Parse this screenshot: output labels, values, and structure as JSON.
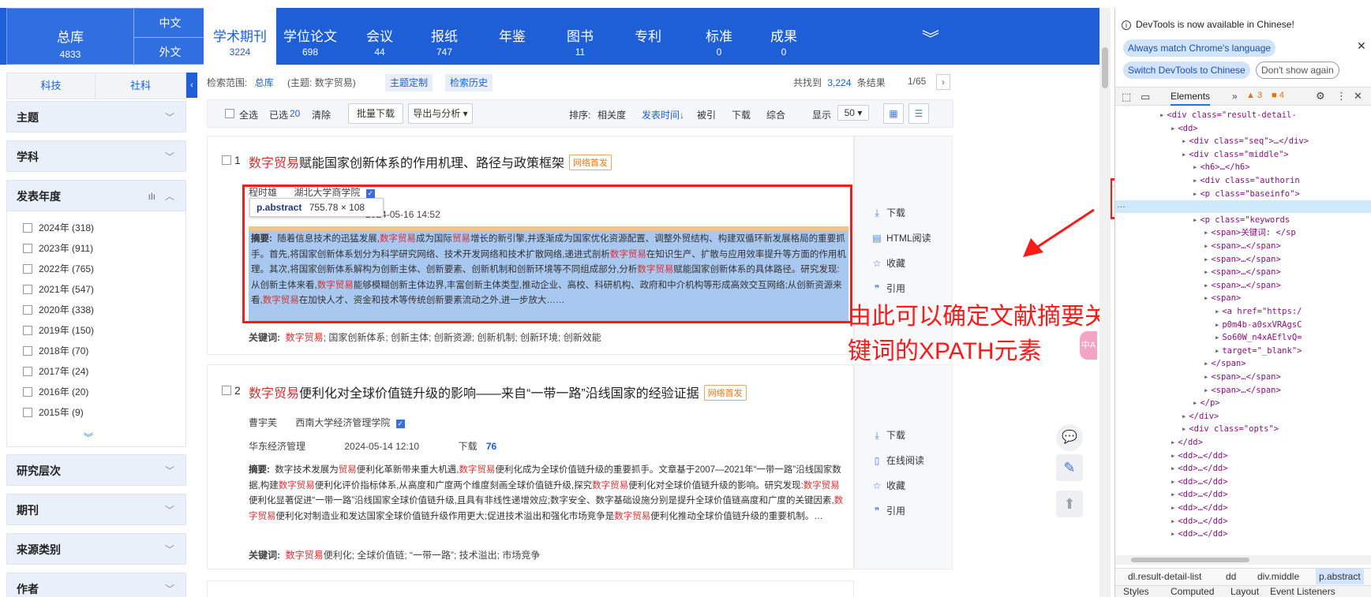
{
  "nav": {
    "zongku_label": "总库",
    "zongku_count": "4833",
    "chinese_label": "中文",
    "foreign_label": "外文",
    "tabs": [
      {
        "label": "学术期刊",
        "count": "3224"
      },
      {
        "label": "学位论文",
        "count": "698"
      },
      {
        "label": "会议",
        "count": "44"
      },
      {
        "label": "报纸",
        "count": "747"
      },
      {
        "label": "年鉴",
        "count": ""
      },
      {
        "label": "图书",
        "count": "11"
      },
      {
        "label": "专利",
        "count": ""
      },
      {
        "label": "标准",
        "count": "0"
      },
      {
        "label": "成果",
        "count": "0"
      }
    ]
  },
  "sidebar": {
    "tabs": [
      "科技",
      "社科"
    ],
    "sections_top": [
      "主题",
      "学科"
    ],
    "year_title": "发表年度",
    "years": [
      "2024年 (318)",
      "2023年 (911)",
      "2022年 (765)",
      "2021年 (547)",
      "2020年 (338)",
      "2019年 (150)",
      "2018年 (70)",
      "2017年 (24)",
      "2016年 (20)",
      "2015年 (9)"
    ],
    "sections_bottom": [
      "研究层次",
      "期刊",
      "来源类别",
      "作者"
    ]
  },
  "search": {
    "scope_label": "检索范围:",
    "scope_value": "总库",
    "topic": "(主题: 数字贸易)",
    "custom_btn": "主题定制",
    "history_btn": "检索历史",
    "found_label": "共找到",
    "found_count": "3,224",
    "found_suffix": "条结果",
    "page": "1/65"
  },
  "toolbar": {
    "select_all": "全选",
    "selected_label": "已选",
    "selected_count": "20",
    "clear": "清除",
    "batch_download": "批量下载",
    "export": "导出与分析",
    "sort_label": "排序:",
    "sort_relevance": "相关度",
    "sort_time": "发表时间",
    "sort_cited": "被引",
    "sort_download": "下载",
    "sort_composite": "综合",
    "display_label": "显示",
    "display_value": "50"
  },
  "results": [
    {
      "num": "1",
      "title_red": "数字贸易",
      "title_rest": "赋能国家创新体系的作用机理、路径与政策框架",
      "badge": "网络首发",
      "author": "程时雄",
      "affiliation": "湖北大学商学院",
      "date": "2024-05-16 14:52",
      "abstract_label": "摘要:",
      "abstract": "随着信息技术的迅猛发展,数字贸易成为国际贸易增长的新引擎,并逐渐成为国家优化资源配置、调整外贸结构、构建双循环新发展格局的重要抓手。首先,将国家创新体系划分为科学研究网络、技术开发网络和技术扩散网络,递进式剖析数字贸易在知识生产、扩散与应用效率提升等方面的作用机理。其次,将国家创新体系解构为创新主体、创新要素、创新机制和创新环境等不同组成部分,分析数字贸易赋能国家创新体系的具体路径。研究发现:从创新主体来看,数字贸易能够模糊创新主体边界,丰富创新主体类型,推动企业、高校、科研机构、政府和中介机构等形成高效交互网络;从创新资源来看,数字贸易在加快人才、资金和技术等传统创新要素流动之外,进一步放大……",
      "keywords_label": "关键词:",
      "keywords": "数字贸易;  国家创新体系;  创新主体;  创新资源;  创新机制;  创新环境;  创新效能",
      "opts": [
        "下载",
        "HTML阅读",
        "收藏",
        "引用"
      ]
    },
    {
      "num": "2",
      "title_red": "数字贸易",
      "title_rest": "便利化对全球价值链升级的影响——来自“一带一路”沿线国家的经验证据",
      "badge": "网络首发",
      "author": "曹宇芙",
      "affiliation": "西南大学经济管理学院",
      "journal": "华东经济管理",
      "date": "2024-05-14 12:10",
      "download_label": "下载",
      "download_count": "76",
      "abstract_label": "摘要:",
      "abstract": "数字技术发展为贸易便利化革新带来重大机遇,数字贸易便利化成为全球价值链升级的重要抓手。文章基于2007—2021年“一带一路”沿线国家数据,构建数字贸易便利化评价指标体系,从高度和广度两个维度刻画全球价值链升级,探究数字贸易便利化对全球价值链升级的影响。研究发现:数字贸易便利化显著促进“一带一路”沿线国家全球价值链升级,且具有非线性递增效应;数字安全、数字基础设施分别是提升全球价值链高度和广度的关键因素,数字贸易便利化对制造业和发达国家全球价值链升级作用更大;促进技术溢出和强化市场竞争是数字贸易便利化推动全球价值链升级的重要机制。…",
      "keywords_label": "关键词:",
      "keywords": "数字贸易便利化;  全球价值链;  “一带一路”;  技术溢出;  市场竞争",
      "opts": [
        "下载",
        "在线阅读",
        "收藏",
        "引用"
      ]
    }
  ],
  "tooltip": {
    "selector": "p.abstract",
    "size": "755.78 × 108"
  },
  "annotation": "由此可以确定文献摘要关键词的XPATH元素",
  "float_badge": "中A",
  "devtools": {
    "banner": "DevTools is now available in Chinese!",
    "btn_match": "Always match Chrome's language",
    "btn_switch": "Switch DevTools to Chinese",
    "btn_dont": "Don't show again",
    "tab_elements": "Elements",
    "warn_count": "3",
    "issue_count": "4",
    "breadcrumb": [
      "dl.result-detail-list",
      "dd",
      "div.middle",
      "p.abstract"
    ],
    "bottom_tabs": [
      "Styles",
      "Computed",
      "Layout",
      "Event Listeners"
    ],
    "tree": [
      {
        "indent": 8,
        "html": "<div class=\"result-detail-"
      },
      {
        "indent": 10,
        "html": "<dd>"
      },
      {
        "indent": 12,
        "html": "<div class=\"seq\">…</div>"
      },
      {
        "indent": 12,
        "html": "<div class=\"middle\">"
      },
      {
        "indent": 14,
        "html": "<h6>…</h6>"
      },
      {
        "indent": 14,
        "html": "<div class=\"authorin"
      },
      {
        "indent": 14,
        "html": "<p class=\"baseinfo\">"
      },
      {
        "indent": 14,
        "html": "<p class=\"abstract\">"
      },
      {
        "indent": 14,
        "html": "<p class=\"keywords"
      },
      {
        "indent": 16,
        "html": "<span>关键词: </sp"
      },
      {
        "indent": 16,
        "html": "<span>…</span>"
      },
      {
        "indent": 16,
        "html": "<span>…</span>"
      },
      {
        "indent": 16,
        "html": "<span>…</span>"
      },
      {
        "indent": 16,
        "html": "<span>…</span>"
      },
      {
        "indent": 16,
        "html": "<span>"
      },
      {
        "indent": 18,
        "html": "<a href=\"https:/"
      },
      {
        "indent": 18,
        "html": "p0m4b-a0sxVRAgsC"
      },
      {
        "indent": 18,
        "html": "So60W_n4xAEflvQ="
      },
      {
        "indent": 18,
        "html": "target=\"_blank\">"
      },
      {
        "indent": 16,
        "html": "</span>"
      },
      {
        "indent": 16,
        "html": "<span>…</span>"
      },
      {
        "indent": 16,
        "html": "<span>…</span>"
      },
      {
        "indent": 14,
        "html": "</p>"
      },
      {
        "indent": 12,
        "html": "</div>"
      },
      {
        "indent": 12,
        "html": "<div class=\"opts\">"
      },
      {
        "indent": 10,
        "html": "</dd>"
      },
      {
        "indent": 10,
        "html": "<dd>…</dd>"
      },
      {
        "indent": 10,
        "html": "<dd>…</dd>"
      },
      {
        "indent": 10,
        "html": "<dd>…</dd>"
      },
      {
        "indent": 10,
        "html": "<dd>…</dd>"
      },
      {
        "indent": 10,
        "html": "<dd>…</dd>"
      },
      {
        "indent": 10,
        "html": "<dd>…</dd>"
      },
      {
        "indent": 10,
        "html": "<dd>…</dd>"
      }
    ]
  },
  "colors": {
    "brand": "#1e5ed6",
    "highlight_red": "#d43030",
    "annotation_red": "#ff1a1a"
  }
}
